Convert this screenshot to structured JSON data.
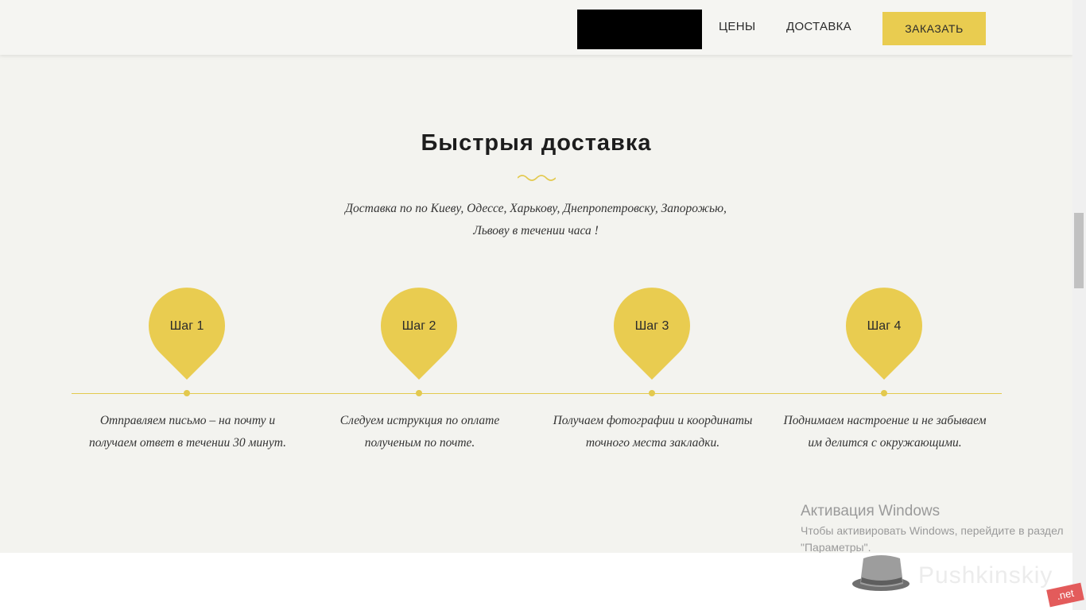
{
  "header": {
    "nav_prices": "ЦЕНЫ",
    "nav_delivery": "ДОСТАВКА",
    "order_button": "ЗАКАЗАТЬ"
  },
  "section": {
    "title": "Быстрыя доставка",
    "intro_line1": "Доставка по по Киеву, Одессе, Харькову, Днепропетровску, Запорожью,",
    "intro_line2": "Львову в течении часа !"
  },
  "steps": [
    {
      "label": "Шаг 1",
      "text": "Отправляем письмо – на почту и получаем ответ в течении 30 минут."
    },
    {
      "label": "Шаг 2",
      "text": "Следуем иструкция по оплате полученым по почте."
    },
    {
      "label": "Шаг 3",
      "text": "Получаем фотографии и координаты точного места закладки."
    },
    {
      "label": "Шаг 4",
      "text": "Поднимаем настроение и не забываем им делится с окружающими."
    }
  ],
  "activation": {
    "title": "Активация Windows",
    "text": "Чтобы активировать Windows, перейдите в раздел \"Параметры\"."
  },
  "watermark": {
    "text": "Pushkinskiy",
    "badge": ".net",
    "icon": "top-hat-icon"
  },
  "colors": {
    "accent": "#e9cc50",
    "background": "#f3f3ef",
    "text": "#2b2b2b"
  }
}
